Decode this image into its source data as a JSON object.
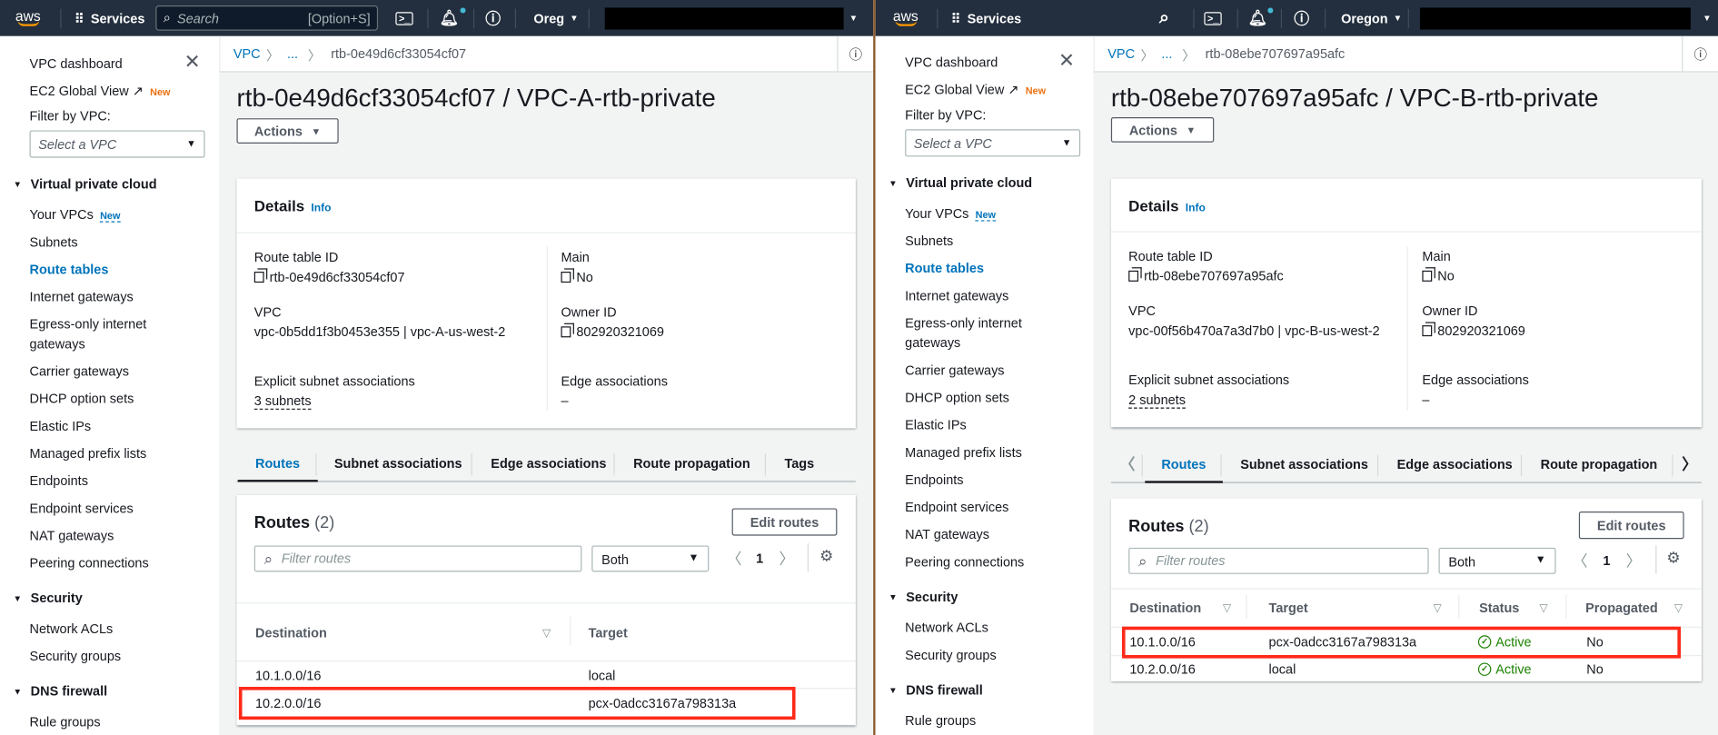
{
  "sidebar": {
    "dashboard": "VPC dashboard",
    "ec2_global_view": "EC2 Global View",
    "new_badge": "New",
    "filter_label": "Filter by VPC:",
    "filter_placeholder": "Select a VPC",
    "sections": [
      {
        "title": "Virtual private cloud",
        "items": [
          "Your VPCs",
          "Subnets",
          "Route tables",
          "Internet gateways",
          "Egress-only internet",
          "gateways",
          "Carrier gateways",
          "DHCP option sets",
          "Elastic IPs",
          "Managed prefix lists",
          "Endpoints",
          "Endpoint services",
          "NAT gateways",
          "Peering connections"
        ]
      },
      {
        "title": "Security",
        "items": [
          "Network ACLs",
          "Security groups"
        ]
      },
      {
        "title": "DNS firewall",
        "items": [
          "Rule groups"
        ]
      }
    ]
  },
  "panels": [
    {
      "topbar": {
        "logo": "aws",
        "services": "Services",
        "search_placeholder": "Search",
        "search_shortcut": "[Option+S]",
        "region": "Oreg"
      },
      "breadcrumb": [
        "VPC",
        "...",
        "rtb-0e49d6cf33054cf07"
      ],
      "title": "rtb-0e49d6cf33054cf07 / VPC-A-rtb-private",
      "actions": "Actions",
      "details": {
        "heading": "Details",
        "info": "Info",
        "route_table_id_label": "Route table ID",
        "route_table_id": "rtb-0e49d6cf33054cf07",
        "main_label": "Main",
        "main": "No",
        "vpc_label": "VPC",
        "vpc": "vpc-0b5dd1f3b0453e355 | vpc-A-us-west-2",
        "owner_label": "Owner ID",
        "owner": "802920321069",
        "subnet_assoc_label": "Explicit subnet associations",
        "subnet_assoc": "3 subnets",
        "edge_assoc_label": "Edge associations",
        "edge_assoc": "–"
      },
      "tabs": [
        "Routes",
        "Subnet associations",
        "Edge associations",
        "Route propagation",
        "Tags"
      ],
      "routes": {
        "title": "Routes",
        "count": "(2)",
        "edit": "Edit routes",
        "filter_placeholder": "Filter routes",
        "select": "Both",
        "page": "1",
        "columns": [
          "Destination",
          "Target"
        ],
        "rows": [
          {
            "destination": "10.1.0.0/16",
            "target": "local"
          },
          {
            "destination": "10.2.0.0/16",
            "target": "pcx-0adcc3167a798313a"
          }
        ]
      }
    },
    {
      "topbar": {
        "logo": "aws",
        "services": "Services",
        "region": "Oregon"
      },
      "breadcrumb": [
        "VPC",
        "...",
        "rtb-08ebe707697a95afc"
      ],
      "title": "rtb-08ebe707697a95afc / VPC-B-rtb-private",
      "actions": "Actions",
      "details": {
        "heading": "Details",
        "info": "Info",
        "route_table_id_label": "Route table ID",
        "route_table_id": "rtb-08ebe707697a95afc",
        "main_label": "Main",
        "main": "No",
        "vpc_label": "VPC",
        "vpc": "vpc-00f56b470a7a3d7b0 | vpc-B-us-west-2",
        "owner_label": "Owner ID",
        "owner": "802920321069",
        "subnet_assoc_label": "Explicit subnet associations",
        "subnet_assoc": "2 subnets",
        "edge_assoc_label": "Edge associations",
        "edge_assoc": "–"
      },
      "tabs": [
        "Routes",
        "Subnet associations",
        "Edge associations",
        "Route propagation"
      ],
      "routes": {
        "title": "Routes",
        "count": "(2)",
        "edit": "Edit routes",
        "filter_placeholder": "Filter routes",
        "select": "Both",
        "page": "1",
        "columns": [
          "Destination",
          "Target",
          "Status",
          "Propagated"
        ],
        "rows": [
          {
            "destination": "10.1.0.0/16",
            "target": "pcx-0adcc3167a798313a",
            "status": "Active",
            "propagated": "No"
          },
          {
            "destination": "10.2.0.0/16",
            "target": "local",
            "status": "Active",
            "propagated": "No"
          }
        ]
      }
    }
  ],
  "colors": {
    "topbar": "#232f3e",
    "link": "#0073bb",
    "active": "#1d8102",
    "highlight": "#ff2a1a",
    "new": "#ec7211"
  }
}
